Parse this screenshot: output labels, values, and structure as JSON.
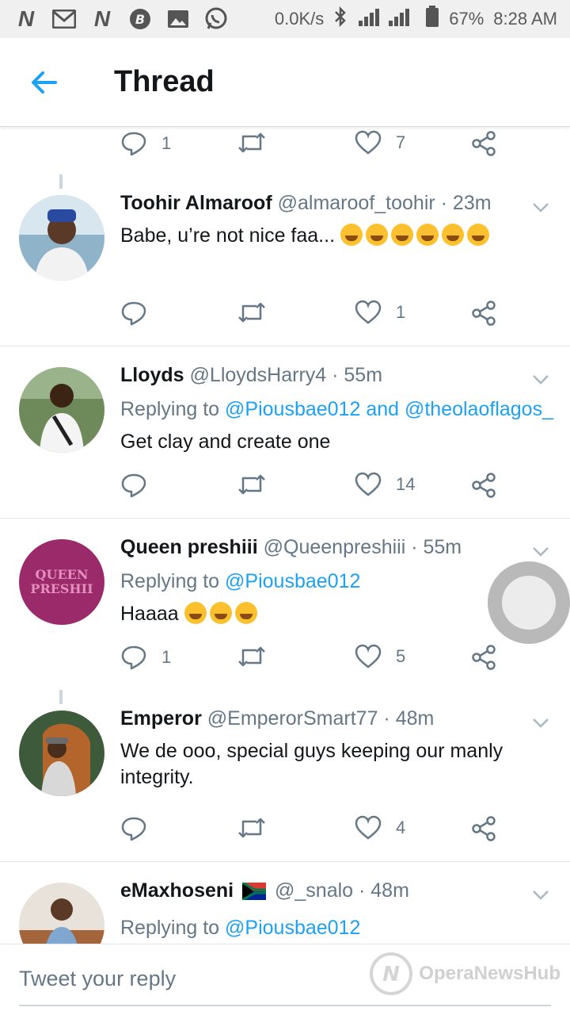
{
  "status_bar": {
    "speed": "0.0K/s",
    "battery": "67%",
    "time": "8:28 AM"
  },
  "appbar": {
    "title": "Thread"
  },
  "top_actions": {
    "reply_count": "1",
    "like_count": "7"
  },
  "tweets": [
    {
      "name": "Toohir Almaroof",
      "handle_time": "@almaroof_toohir · 23m",
      "text": "Babe, u’re not nice faa...",
      "reply_count": "",
      "like_count": "1"
    },
    {
      "name": "Lloyds",
      "handle_time": "@LloydsHarry4 · 55m",
      "replying_prefix": "Replying to",
      "replying_to": "@Piousbae012 and @theolaoflagos_",
      "text": "Get clay and create one",
      "reply_count": "",
      "like_count": "14"
    },
    {
      "name": "Queen preshiii",
      "handle_time": "@Queenpreshiii · 55m",
      "replying_prefix": "Replying to",
      "replying_to": "@Piousbae012",
      "text": "Haaaa",
      "avatar_text": "QUEEN PRESHII",
      "reply_count": "1",
      "like_count": "5"
    },
    {
      "name": "Emperor",
      "handle_time": "@EmperorSmart77 · 48m",
      "text": "We de ooo, special guys keeping our  manly integrity.",
      "reply_count": "",
      "like_count": "4"
    },
    {
      "name": "eMaxhoseni",
      "handle_time": "@_snalo · 48m",
      "replying_prefix": "Replying to",
      "replying_to": "@Piousbae012"
    }
  ],
  "reply_bar": {
    "placeholder": "Tweet your reply"
  },
  "watermark": "OperaNewsHub",
  "colors": {
    "accent": "#1da1f2",
    "muted": "#657786"
  }
}
